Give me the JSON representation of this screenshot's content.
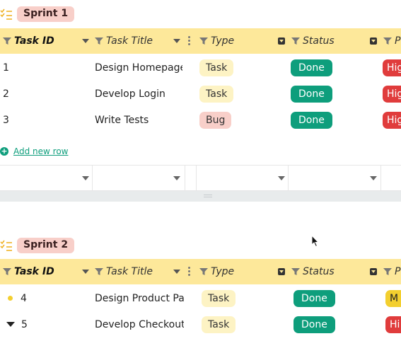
{
  "groups": [
    {
      "title": "Sprint 1",
      "columns": {
        "task_id": "Task ID",
        "task_title": "Task Title",
        "type": "Type",
        "status": "Status",
        "priority": "P"
      },
      "rows": [
        {
          "id": "1",
          "title": "Design Homepage",
          "type": "Task",
          "status": "Done",
          "priority": "Hig"
        },
        {
          "id": "2",
          "title": "Develop Login",
          "type": "Task",
          "status": "Done",
          "priority": "Hig"
        },
        {
          "id": "3",
          "title": "Write Tests",
          "type": "Bug",
          "status": "Done",
          "priority": "Hig"
        }
      ],
      "add_row_label": "Add new row"
    },
    {
      "title": "Sprint 2",
      "columns": {
        "task_id": "Task ID",
        "task_title": "Task Title",
        "type": "Type",
        "status": "Status",
        "priority": "P"
      },
      "rows": [
        {
          "id": "4",
          "title": "Design Product Pag",
          "type": "Task",
          "status": "Done",
          "priority": "M"
        },
        {
          "id": "5",
          "title": "Develop Checkout",
          "type": "Task",
          "status": "Done",
          "priority": "Hi"
        }
      ]
    }
  ],
  "colors": {
    "header_bg": "#fde89a",
    "group_pill": "#f8cfc9",
    "done": "#0e9e7c",
    "high": "#e03c3c",
    "medium": "#f3cf2f",
    "task_chip": "#fdf3c4",
    "bug_chip": "#f8cfc9"
  },
  "icons": {
    "group": "checklist-icon",
    "filter": "filter-icon",
    "dropdown": "chevron-down-icon",
    "menu": "kebab-menu-icon",
    "add": "plus-circle-icon",
    "cursor": "mouse-pointer-icon"
  }
}
